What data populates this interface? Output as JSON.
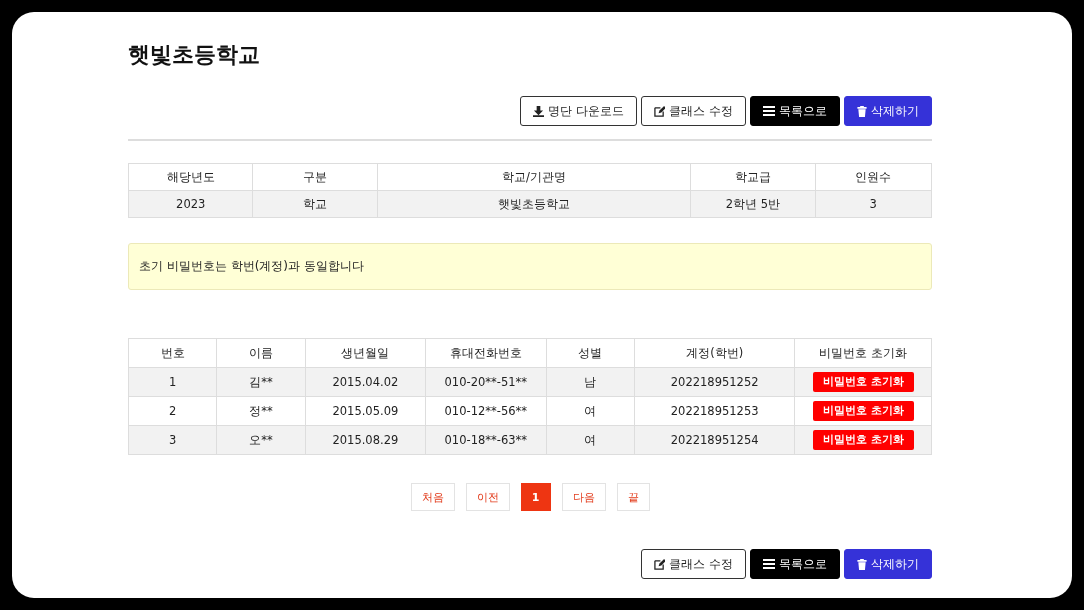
{
  "title": "햇빛초등학교",
  "top_buttons": [
    {
      "kind": "download",
      "label": "명단 다운로드"
    },
    {
      "kind": "edit",
      "label": "클래스 수정"
    },
    {
      "kind": "list",
      "label": "목록으로"
    },
    {
      "kind": "delete",
      "label": "삭제하기"
    }
  ],
  "info_table": {
    "columns": [
      "해당년도",
      "구분",
      "학교/기관명",
      "학교급",
      "인원수"
    ],
    "rows": [
      [
        "2023",
        "학교",
        "햇빛초등학교",
        "2학년 5반",
        "3"
      ]
    ]
  },
  "notice": "초기 비밀번호는 학번(계정)과 동일합니다",
  "student_table": {
    "columns": [
      "번호",
      "이름",
      "생년월일",
      "휴대전화번호",
      "성별",
      "계정(학번)",
      "비밀번호 초기화"
    ],
    "rows": [
      {
        "cells": [
          "1",
          "김**",
          "2015.04.02",
          "010-20**-51**",
          "남",
          "202218951252"
        ],
        "action": "비밀번호 초기화"
      },
      {
        "cells": [
          "2",
          "정**",
          "2015.05.09",
          "010-12**-56**",
          "여",
          "202218951253"
        ],
        "action": "비밀번호 초기화"
      },
      {
        "cells": [
          "3",
          "오**",
          "2015.08.29",
          "010-18**-63**",
          "여",
          "202218951254"
        ],
        "action": "비밀번호 초기화"
      }
    ]
  },
  "pagination": [
    {
      "label": "처음",
      "selected": false
    },
    {
      "label": "이전",
      "selected": false
    },
    {
      "label": "1",
      "selected": true
    },
    {
      "label": "다음",
      "selected": false
    },
    {
      "label": "끝",
      "selected": false
    }
  ],
  "bottom_buttons": [
    {
      "kind": "edit",
      "label": "클래스 수정"
    },
    {
      "kind": "list",
      "label": "목록으로"
    },
    {
      "kind": "delete",
      "label": "삭제하기"
    }
  ]
}
